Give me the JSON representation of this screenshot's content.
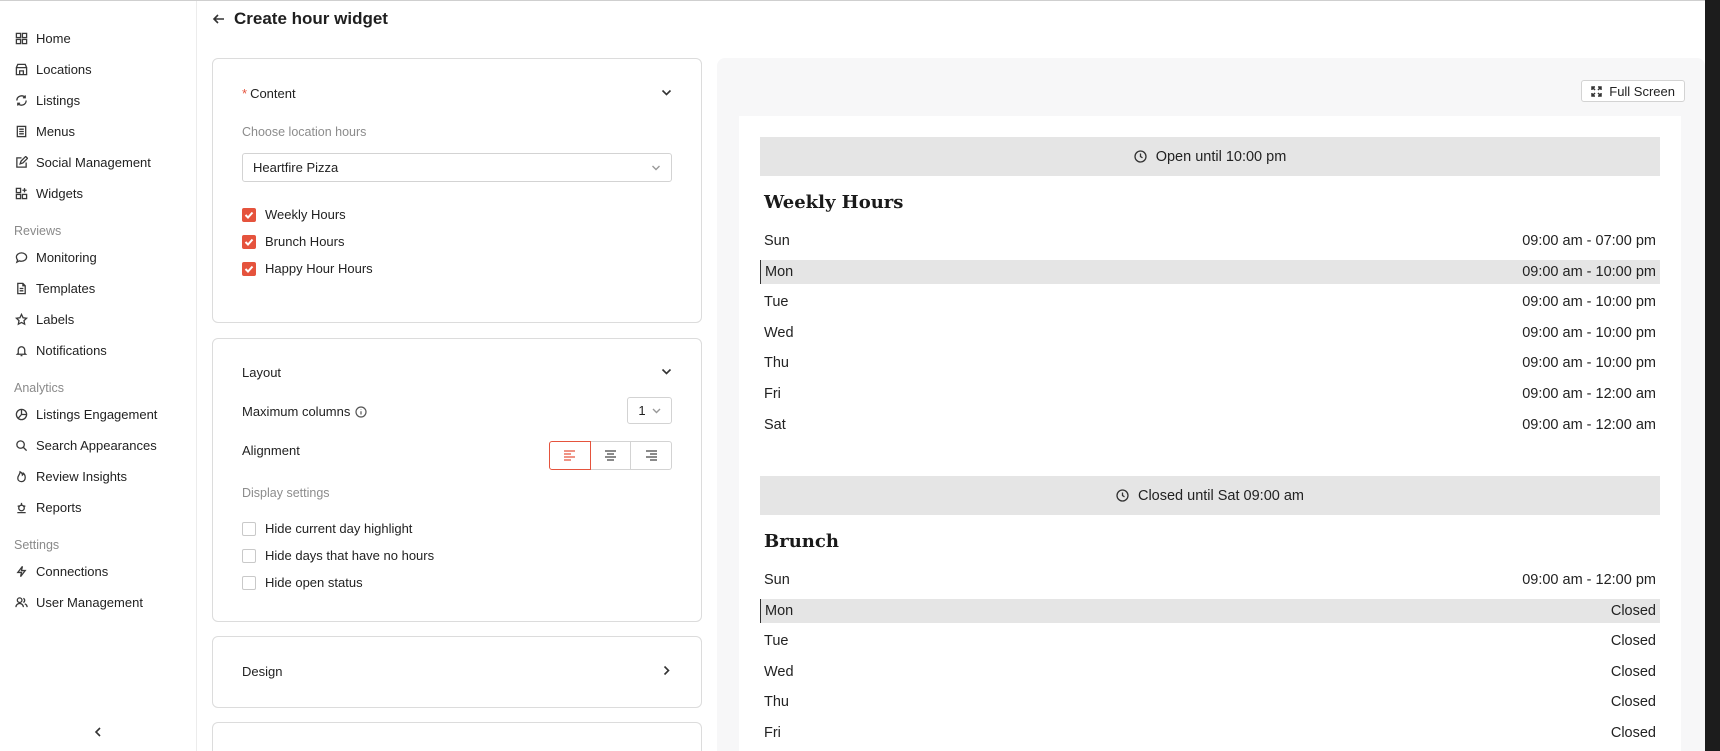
{
  "sidebar": {
    "items": [
      {
        "label": "Home",
        "icon": "grid-icon"
      },
      {
        "label": "Locations",
        "icon": "store-icon"
      },
      {
        "label": "Listings",
        "icon": "refresh-icon"
      },
      {
        "label": "Menus",
        "icon": "menu-book-icon"
      },
      {
        "label": "Social Management",
        "icon": "edit-icon"
      },
      {
        "label": "Widgets",
        "icon": "widgets-icon"
      }
    ],
    "reviews_label": "Reviews",
    "reviews_items": [
      {
        "label": "Monitoring",
        "icon": "chat-icon"
      },
      {
        "label": "Templates",
        "icon": "document-icon"
      },
      {
        "label": "Labels",
        "icon": "star-icon"
      },
      {
        "label": "Notifications",
        "icon": "bell-icon"
      }
    ],
    "analytics_label": "Analytics",
    "analytics_items": [
      {
        "label": "Listings Engagement",
        "icon": "pie-chart-icon"
      },
      {
        "label": "Search Appearances",
        "icon": "search-icon"
      },
      {
        "label": "Review Insights",
        "icon": "flame-icon"
      },
      {
        "label": "Reports",
        "icon": "report-icon"
      }
    ],
    "settings_label": "Settings",
    "settings_items": [
      {
        "label": "Connections",
        "icon": "lightning-icon"
      },
      {
        "label": "User Management",
        "icon": "users-icon"
      }
    ]
  },
  "header": {
    "title": "Create hour widget"
  },
  "content_panel": {
    "title": "Content",
    "required_mark": "*",
    "choose_label": "Choose location hours",
    "location_value": "Heartfire Pizza",
    "checkboxes": [
      {
        "label": "Weekly Hours",
        "checked": true
      },
      {
        "label": "Brunch Hours",
        "checked": true
      },
      {
        "label": "Happy Hour Hours",
        "checked": true
      }
    ]
  },
  "layout_panel": {
    "title": "Layout",
    "max_columns_label": "Maximum columns",
    "max_columns_value": "1",
    "alignment_label": "Alignment",
    "alignment_selected": "left",
    "display_settings_label": "Display settings",
    "checkboxes": [
      {
        "label": "Hide current day highlight",
        "checked": false
      },
      {
        "label": "Hide days that have no hours",
        "checked": false
      },
      {
        "label": "Hide open status",
        "checked": false
      }
    ]
  },
  "design_panel": {
    "title": "Design"
  },
  "preview": {
    "fullscreen_label": "Full Screen",
    "sections": [
      {
        "status": "Open until 10:00 pm",
        "title": "Weekly Hours",
        "rows": [
          {
            "day": "Sun",
            "hours": "09:00 am - 07:00 pm",
            "today": false
          },
          {
            "day": "Mon",
            "hours": "09:00 am - 10:00 pm",
            "today": true
          },
          {
            "day": "Tue",
            "hours": "09:00 am - 10:00 pm",
            "today": false
          },
          {
            "day": "Wed",
            "hours": "09:00 am - 10:00 pm",
            "today": false
          },
          {
            "day": "Thu",
            "hours": "09:00 am - 10:00 pm",
            "today": false
          },
          {
            "day": "Fri",
            "hours": "09:00 am - 12:00 am",
            "today": false
          },
          {
            "day": "Sat",
            "hours": "09:00 am - 12:00 am",
            "today": false
          }
        ]
      },
      {
        "status": "Closed until Sat 09:00 am",
        "title": "Brunch",
        "rows": [
          {
            "day": "Sun",
            "hours": "09:00 am - 12:00 pm",
            "today": false
          },
          {
            "day": "Mon",
            "hours": "Closed",
            "today": true
          },
          {
            "day": "Tue",
            "hours": "Closed",
            "today": false
          },
          {
            "day": "Wed",
            "hours": "Closed",
            "today": false
          },
          {
            "day": "Thu",
            "hours": "Closed",
            "today": false
          },
          {
            "day": "Fri",
            "hours": "Closed",
            "today": false
          }
        ]
      }
    ]
  },
  "colors": {
    "accent": "#e5533d",
    "highlight": "#e5e5e5"
  }
}
